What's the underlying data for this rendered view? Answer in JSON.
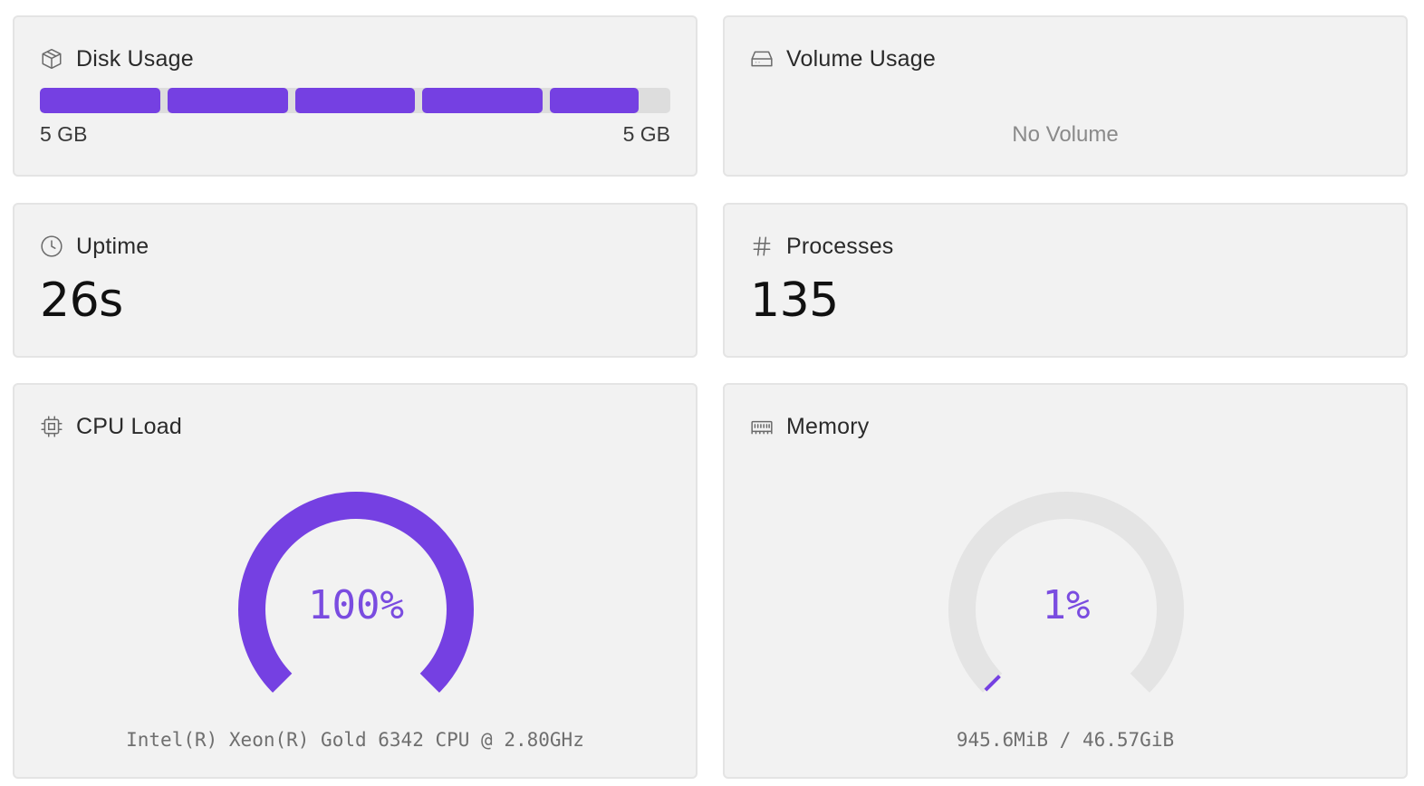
{
  "colors": {
    "accent": "#7540e2",
    "track": "#e4e4e4",
    "card_bg": "#f2f2f2",
    "card_border": "#e4e4e4"
  },
  "disk": {
    "title": "Disk Usage",
    "icon": "package-icon",
    "used_label": "5 GB",
    "total_label": "5 GB",
    "fill_fraction": 0.95,
    "segments": 5
  },
  "volume": {
    "title": "Volume Usage",
    "icon": "hard-drive-icon",
    "empty_text": "No Volume"
  },
  "uptime": {
    "title": "Uptime",
    "icon": "clock-icon",
    "value": "26s"
  },
  "processes": {
    "title": "Processes",
    "icon": "hash-icon",
    "value": "135"
  },
  "cpu": {
    "title": "CPU Load",
    "icon": "cpu-icon",
    "percent_label": "100%",
    "fraction": 1.0,
    "model": "Intel(R) Xeon(R) Gold 6342 CPU @ 2.80GHz"
  },
  "memory": {
    "title": "Memory",
    "icon": "memory-stick-icon",
    "percent_label": "1%",
    "fraction": 0.01,
    "usage": "945.6MiB / 46.57GiB"
  }
}
